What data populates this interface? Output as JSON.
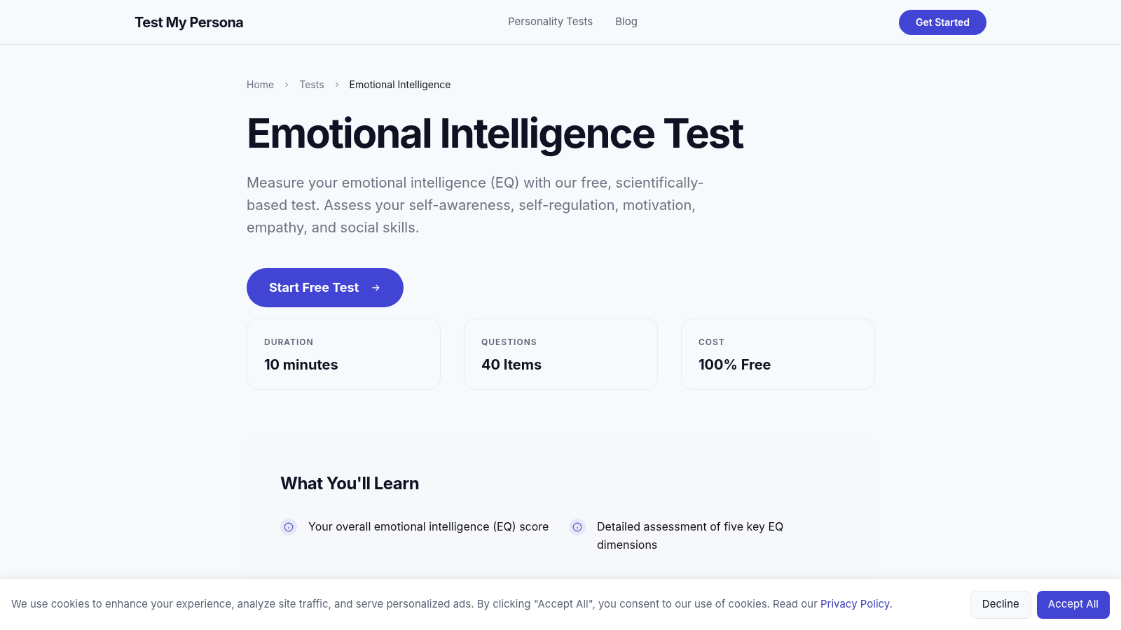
{
  "nav": {
    "logo": "Test My Persona",
    "links": [
      "Personality Tests",
      "Blog"
    ],
    "cta": "Get Started"
  },
  "breadcrumb": [
    "Home",
    "Tests",
    "Emotional Intelligence"
  ],
  "hero": {
    "title": "Emotional Intelligence Test",
    "description": "Measure your emotional intelligence (EQ) with our free, scientifically-based test. Assess your self-awareness, self-regulation, motivation, empathy, and social skills.",
    "button": "Start Free Test"
  },
  "stats": [
    {
      "label": "DURATION",
      "value": "10 minutes"
    },
    {
      "label": "QUESTIONS",
      "value": "40 Items"
    },
    {
      "label": "COST",
      "value": "100% Free"
    }
  ],
  "learn": {
    "title": "What You'll Learn",
    "items": [
      "Your overall emotional intelligence (EQ) score",
      "Detailed assessment of five key EQ dimensions"
    ]
  },
  "cookie": {
    "text": "We use cookies to enhance your experience, analyze site traffic, and serve personalized ads. By clicking \"Accept All\", you consent to our use of cookies. Read our ",
    "link": "Privacy Policy",
    "after": ".",
    "decline": "Decline",
    "accept": "Accept All"
  }
}
